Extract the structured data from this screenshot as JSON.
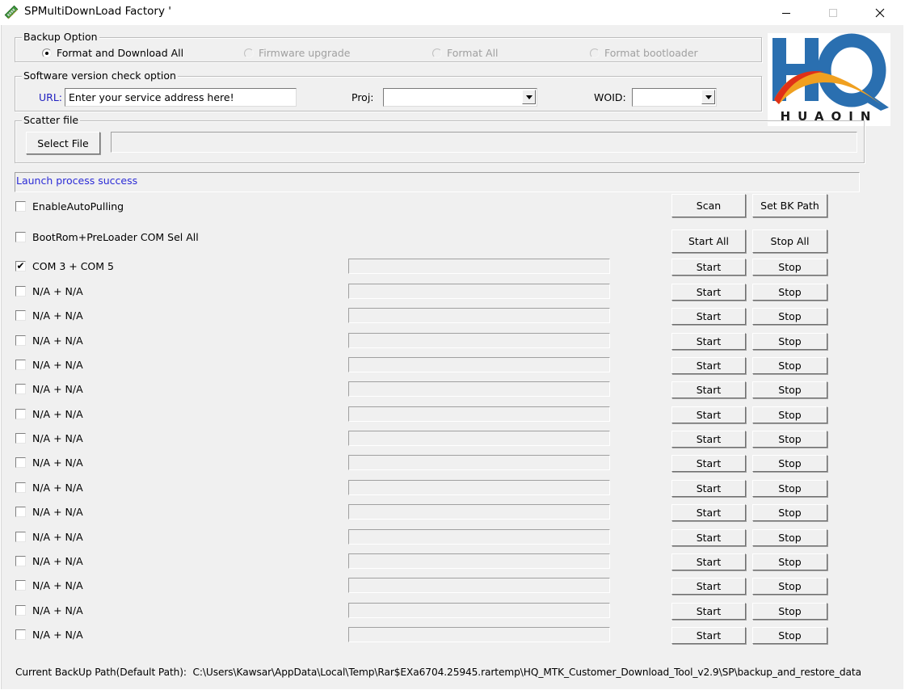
{
  "window": {
    "title": "SPMultiDownLoad Factory '",
    "app_icon": "memory-stick-icon",
    "controls": {
      "minimize": "minimize-icon",
      "maximize": "maximize-icon",
      "close": "close-icon"
    }
  },
  "backup_option": {
    "legend": "Backup Option",
    "options": [
      {
        "label": "Format and Download All",
        "selected": true,
        "enabled": true
      },
      {
        "label": "Firmware upgrade",
        "selected": false,
        "enabled": false
      },
      {
        "label": "Format All",
        "selected": false,
        "enabled": false
      },
      {
        "label": "Format bootloader",
        "selected": false,
        "enabled": false
      }
    ]
  },
  "version_check": {
    "legend": "Software version check option",
    "url_label": "URL:",
    "url_value": "Enter your service address here!",
    "proj_label": "Proj:",
    "proj_value": "",
    "woid_label": "WOID:",
    "woid_value": ""
  },
  "scatter": {
    "legend": "Scatter file",
    "select_button": "Select File",
    "path_value": ""
  },
  "status": {
    "message": "Launch process success",
    "color": "#2b2bd6"
  },
  "logo": {
    "brand": "HUAQIN",
    "letters": "HQ",
    "color": "#2a6fb0"
  },
  "controls": {
    "auto_pulling": {
      "label": "EnableAutoPulling",
      "checked": false
    },
    "com_sel_all": {
      "label": "BootRom+PreLoader COM Sel All",
      "checked": false
    },
    "scan": "Scan",
    "set_bk_path": "Set BK Path",
    "start_all": "Start All",
    "stop_all": "Stop All"
  },
  "ports": [
    {
      "label": "COM 3 + COM 5",
      "checked": true,
      "progress": 0,
      "start": "Start",
      "stop": "Stop"
    },
    {
      "label": "N/A + N/A",
      "checked": false,
      "progress": 0,
      "start": "Start",
      "stop": "Stop"
    },
    {
      "label": "N/A + N/A",
      "checked": false,
      "progress": 0,
      "start": "Start",
      "stop": "Stop"
    },
    {
      "label": "N/A + N/A",
      "checked": false,
      "progress": 0,
      "start": "Start",
      "stop": "Stop"
    },
    {
      "label": "N/A + N/A",
      "checked": false,
      "progress": 0,
      "start": "Start",
      "stop": "Stop"
    },
    {
      "label": "N/A + N/A",
      "checked": false,
      "progress": 0,
      "start": "Start",
      "stop": "Stop"
    },
    {
      "label": "N/A + N/A",
      "checked": false,
      "progress": 0,
      "start": "Start",
      "stop": "Stop"
    },
    {
      "label": "N/A + N/A",
      "checked": false,
      "progress": 0,
      "start": "Start",
      "stop": "Stop"
    },
    {
      "label": "N/A + N/A",
      "checked": false,
      "progress": 0,
      "start": "Start",
      "stop": "Stop"
    },
    {
      "label": "N/A + N/A",
      "checked": false,
      "progress": 0,
      "start": "Start",
      "stop": "Stop"
    },
    {
      "label": "N/A + N/A",
      "checked": false,
      "progress": 0,
      "start": "Start",
      "stop": "Stop"
    },
    {
      "label": "N/A + N/A",
      "checked": false,
      "progress": 0,
      "start": "Start",
      "stop": "Stop"
    },
    {
      "label": "N/A + N/A",
      "checked": false,
      "progress": 0,
      "start": "Start",
      "stop": "Stop"
    },
    {
      "label": "N/A + N/A",
      "checked": false,
      "progress": 0,
      "start": "Start",
      "stop": "Stop"
    },
    {
      "label": "N/A + N/A",
      "checked": false,
      "progress": 0,
      "start": "Start",
      "stop": "Stop"
    },
    {
      "label": "N/A + N/A",
      "checked": false,
      "progress": 0,
      "start": "Start",
      "stop": "Stop"
    }
  ],
  "footer": {
    "label": "Current BackUp Path(Default Path):",
    "path": "C:\\Users\\Kawsar\\AppData\\Local\\Temp\\Rar$EXa6704.25945.rartemp\\HQ_MTK_Customer_Download_Tool_v2.9\\SP\\backup_and_restore_data"
  }
}
